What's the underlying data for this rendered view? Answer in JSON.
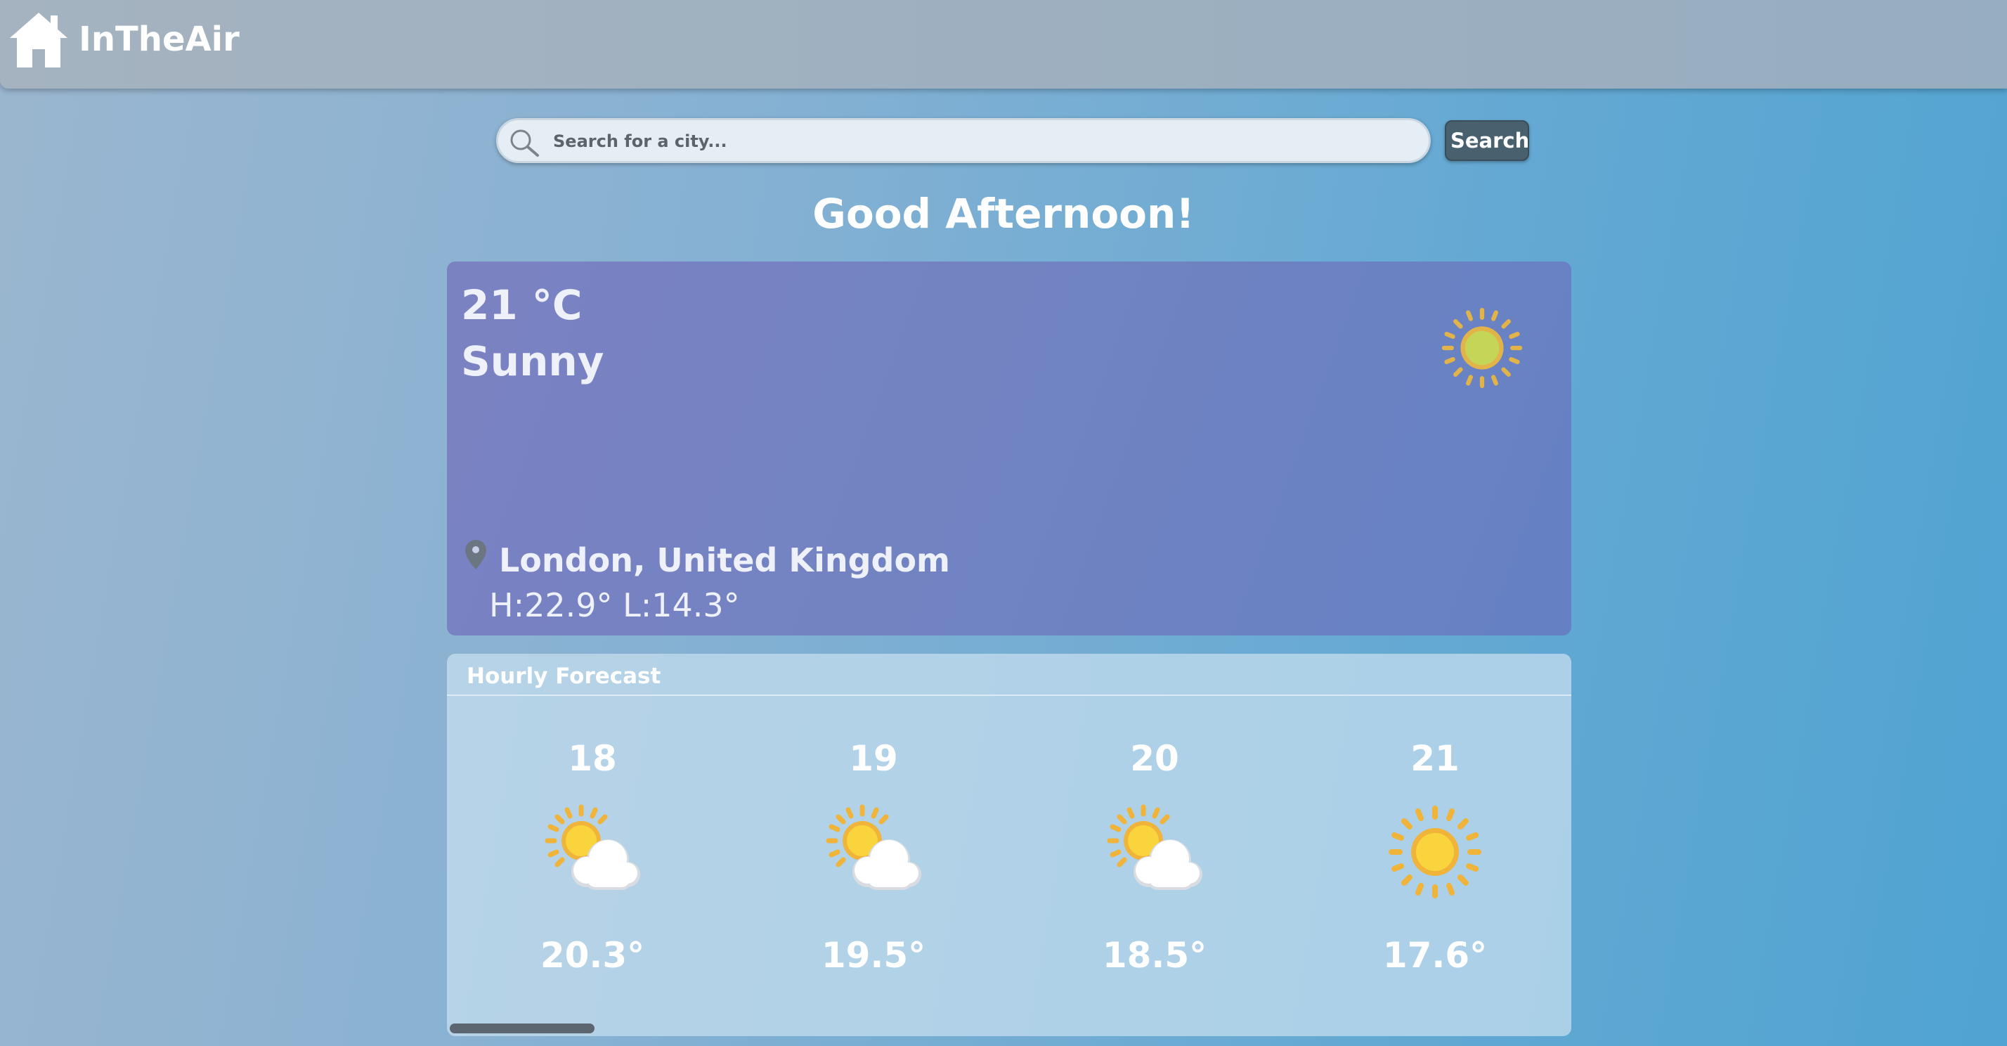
{
  "app": {
    "name": "InTheAir"
  },
  "search": {
    "placeholder": "Search for a city...",
    "button_label": "Search"
  },
  "greeting": "Good Afternoon!",
  "current": {
    "temperature": "21 °C",
    "condition": "Sunny",
    "condition_icon": "sun-icon",
    "location": "London, United Kingdom",
    "high_low": "H:22.9° L:14.3°"
  },
  "hourly": {
    "title": "Hourly Forecast",
    "items": [
      {
        "hour": "18",
        "temp": "20.3°",
        "icon": "partly-cloudy-icon"
      },
      {
        "hour": "19",
        "temp": "19.5°",
        "icon": "partly-cloudy-icon"
      },
      {
        "hour": "20",
        "temp": "18.5°",
        "icon": "partly-cloudy-icon"
      },
      {
        "hour": "21",
        "temp": "17.6°",
        "icon": "sun-icon"
      }
    ]
  },
  "colors": {
    "card_current": "#7283c2",
    "search_button": "#49606f",
    "sun": "#f3c12d"
  }
}
